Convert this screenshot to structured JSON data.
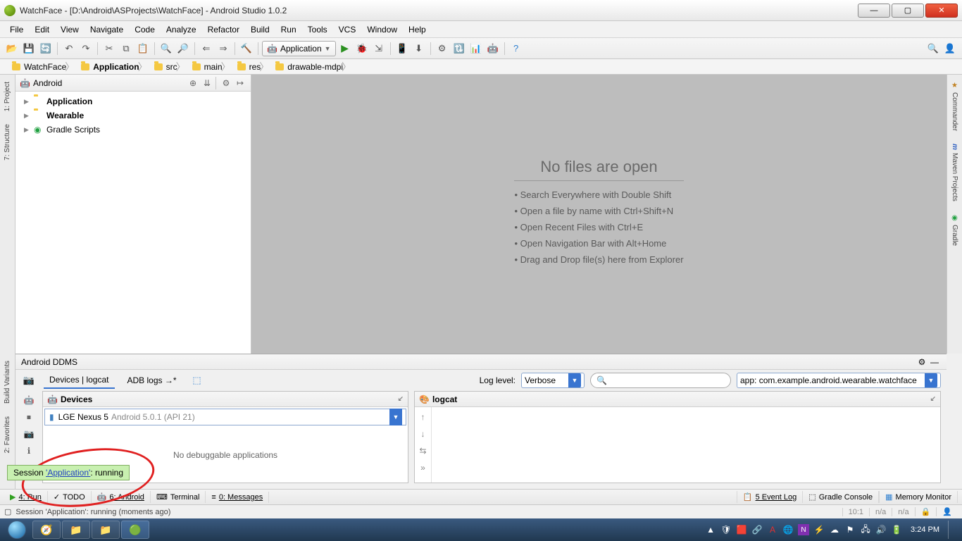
{
  "window": {
    "title": "WatchFace - [D:\\Android\\ASProjects\\WatchFace] - Android Studio 1.0.2"
  },
  "menus": [
    "File",
    "Edit",
    "View",
    "Navigate",
    "Code",
    "Analyze",
    "Refactor",
    "Build",
    "Run",
    "Tools",
    "VCS",
    "Window",
    "Help"
  ],
  "run_config": {
    "label": "Application"
  },
  "breadcrumb": [
    "WatchFace",
    "Application",
    "src",
    "main",
    "res",
    "drawable-mdpi"
  ],
  "project_view": {
    "selector": "Android",
    "items": [
      {
        "name": "Application",
        "bold": true
      },
      {
        "name": "Wearable",
        "bold": true
      },
      {
        "name": "Gradle Scripts",
        "bold": false
      }
    ]
  },
  "editor_empty": {
    "heading": "No files are open",
    "hints": [
      "Search Everywhere with Double Shift",
      "Open a file by name with Ctrl+Shift+N",
      "Open Recent Files with Ctrl+E",
      "Open Navigation Bar with Alt+Home",
      "Drag and Drop file(s) here from Explorer"
    ]
  },
  "ddms": {
    "title": "Android DDMS",
    "tabs": [
      "Devices | logcat",
      "ADB logs"
    ],
    "log_level_label": "Log level:",
    "log_level_value": "Verbose",
    "search_placeholder": "",
    "filter_value": "app: com.example.android.wearable.watchface",
    "devices_title": "Devices",
    "device_name": "LGE Nexus 5",
    "device_detail": "Android 5.0.1 (API 21)",
    "no_debug": "No debuggable applications",
    "logcat_title": "logcat"
  },
  "session_toast": {
    "prefix": "Session ",
    "link": "'Application'",
    "suffix": ": running"
  },
  "bottom_tabs": {
    "run": "4: Run",
    "todo": "TODO",
    "android": "6: Android",
    "terminal": "Terminal",
    "messages": "0: Messages",
    "event_log": "5  Event Log",
    "gradle_console": "Gradle Console",
    "memory_monitor": "Memory Monitor"
  },
  "statusbar": {
    "message": "Session 'Application': running (moments ago)",
    "pos": "10:1",
    "enc1": "n/a",
    "enc2": "n/a"
  },
  "left_tabs": [
    "1: Project",
    "7: Structure",
    "2: Favorites",
    "Build Variants"
  ],
  "right_tabs": [
    "Commander",
    "Maven Projects",
    "Gradle"
  ],
  "taskbar": {
    "time": "3:24 PM"
  }
}
